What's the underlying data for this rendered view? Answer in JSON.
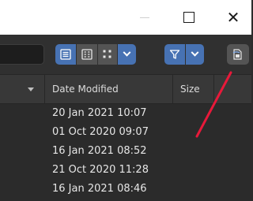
{
  "window_controls": {
    "minimize_label": "—",
    "maximize_label": "☐",
    "close_label": "✕"
  },
  "header": {
    "buttons": [
      {
        "name": "display-list-button",
        "icon": "list-icon",
        "active": true
      },
      {
        "name": "display-vertical-list-button",
        "icon": "vertical-list-icon",
        "active": false
      },
      {
        "name": "display-thumbnails-button",
        "icon": "thumbnails-icon",
        "active": false
      },
      {
        "name": "display-mode-dropdown",
        "icon": "chevron-down-icon",
        "active": true
      },
      {
        "name": "filter-toggle-button",
        "icon": "funnel-icon",
        "active": true
      },
      {
        "name": "filter-settings-dropdown",
        "icon": "chevron-down-icon",
        "active": true
      },
      {
        "name": "show-hidden-files-button",
        "icon": "hidden-files-icon",
        "active": false
      }
    ],
    "accent_color": "#4772b3"
  },
  "columns": {
    "date_modified": "Date Modified",
    "size": "Size"
  },
  "rows": [
    {
      "date": "20 Jan 2021 10:07"
    },
    {
      "date": "01 Oct 2020 09:07"
    },
    {
      "date": "16 Jan 2021 08:52"
    },
    {
      "date": "21 Oct 2020 11:28"
    },
    {
      "date": "16 Jan 2021 08:46"
    }
  ],
  "annotation": {
    "color": "#e8193a"
  }
}
